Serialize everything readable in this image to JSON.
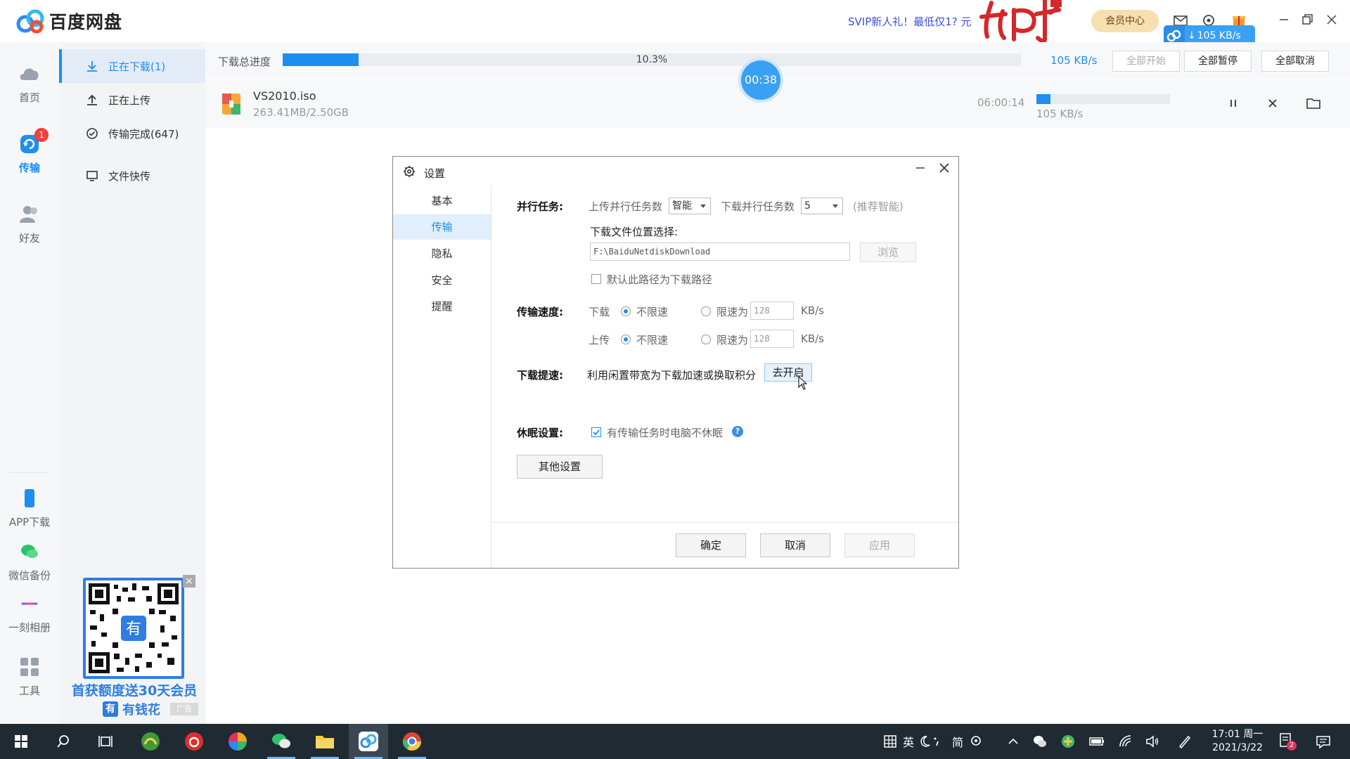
{
  "app": {
    "title": "百度网盘"
  },
  "header": {
    "promo": "SVIP新人礼！最低仅1? 元",
    "vip_button": "会员中心",
    "speed_pill": "105 KB/s"
  },
  "rail": {
    "home": "首页",
    "transfer": "传输",
    "transfer_badge": "1",
    "friends": "好友",
    "app_download": "APP下载",
    "wechat_backup": "微信备份",
    "album": "一刻相册",
    "tools": "工具"
  },
  "subnav": {
    "items": [
      {
        "label": "正在下载(1)"
      },
      {
        "label": "正在上传"
      },
      {
        "label": "传输完成(647)"
      },
      {
        "label": "文件快传"
      }
    ]
  },
  "ad": {
    "title": "首获额度送30天会员",
    "brand": "有钱花",
    "brand_icon": "有",
    "tag": "广告",
    "close": "×"
  },
  "toolbar": {
    "progress_label": "下载总进度",
    "progress_pct": "10.3%",
    "progress_value": 0.103,
    "speed": "105 KB/s",
    "start_all": "全部开始",
    "pause_all": "全部暂停",
    "cancel_all": "全部取消"
  },
  "task": {
    "name": "VS2010.iso",
    "size": "263.41MB/2.50GB",
    "remaining": "06:00:14",
    "speed": "105 KB/s",
    "progress_value": 0.103
  },
  "timer": "00:38",
  "dialog": {
    "title": "设置",
    "tabs": [
      "基本",
      "传输",
      "隐私",
      "安全",
      "提醒"
    ],
    "active_tab": 1,
    "parallel": {
      "label": "并行任务:",
      "upload_label": "上传并行任务数",
      "upload_value": "智能",
      "download_label": "下载并行任务数",
      "download_value": "5",
      "hint": "(推荐智能)"
    },
    "location": {
      "label": "下载文件位置选择:",
      "path": "F:\\BaiduNetdiskDownload",
      "browse": "浏览",
      "default_check": "默认此路径为下载路径"
    },
    "speed": {
      "label": "传输速度:",
      "download": "下载",
      "upload": "上传",
      "unlimited": "不限速",
      "limit_to": "限速为",
      "limit_value": "128",
      "unit": "KB/s"
    },
    "boost": {
      "label": "下载提速:",
      "desc": "利用闲置带宽为下载加速或换取积分",
      "button": "去开启"
    },
    "sleep": {
      "label": "休眠设置:",
      "check": "有传输任务时电脑不休眠",
      "help": "?"
    },
    "other_settings": "其他设置",
    "ok": "确定",
    "cancel": "取消",
    "apply": "应用"
  },
  "taskbar": {
    "ime_lang": "英",
    "ime_mode": "简",
    "time": "17:01 周一",
    "date": "2021/3/22",
    "notif_badge": "2"
  },
  "colors": {
    "accent": "#1c8ff0",
    "taskbar": "#1f2a33",
    "vip_gold": "#f8dfb0"
  }
}
